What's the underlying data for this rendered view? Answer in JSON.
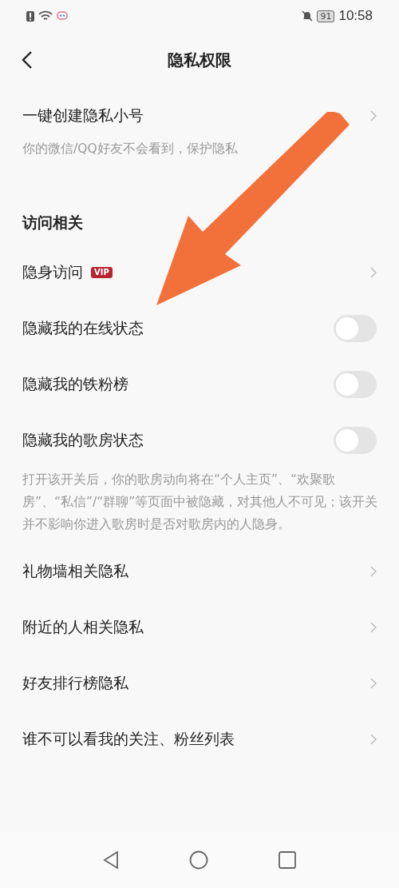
{
  "status_bar": {
    "time": "10:58",
    "battery": "91"
  },
  "header": {
    "title": "隐私权限"
  },
  "sections": [
    {
      "items": [
        {
          "kind": "link",
          "label": "一键创建隐私小号",
          "note": "你的微信/QQ好友不会看到，保护隐私"
        }
      ]
    },
    {
      "title": "访问相关",
      "items": [
        {
          "kind": "link",
          "label": "隐身访问",
          "badge": "VIP"
        },
        {
          "kind": "toggle",
          "label": "隐藏我的在线状态",
          "on": false
        },
        {
          "kind": "toggle",
          "label": "隐藏我的铁粉榜",
          "on": false
        },
        {
          "kind": "toggle",
          "label": "隐藏我的歌房状态",
          "on": false,
          "note": "打开该开关后，你的歌房动向将在“个人主页”、“欢聚歌房”、“私信”/“群聊”等页面中被隐藏，对其他人不可见；该开关并不影响你进入歌房时是否对歌房内的人隐身。"
        },
        {
          "kind": "link",
          "label": "礼物墙相关隐私"
        },
        {
          "kind": "link",
          "label": "附近的人相关隐私"
        },
        {
          "kind": "link",
          "label": "好友排行榜隐私"
        },
        {
          "kind": "link",
          "label": "谁不可以看我的关注、粉丝列表"
        }
      ]
    }
  ],
  "annotation": {
    "kind": "arrow"
  }
}
